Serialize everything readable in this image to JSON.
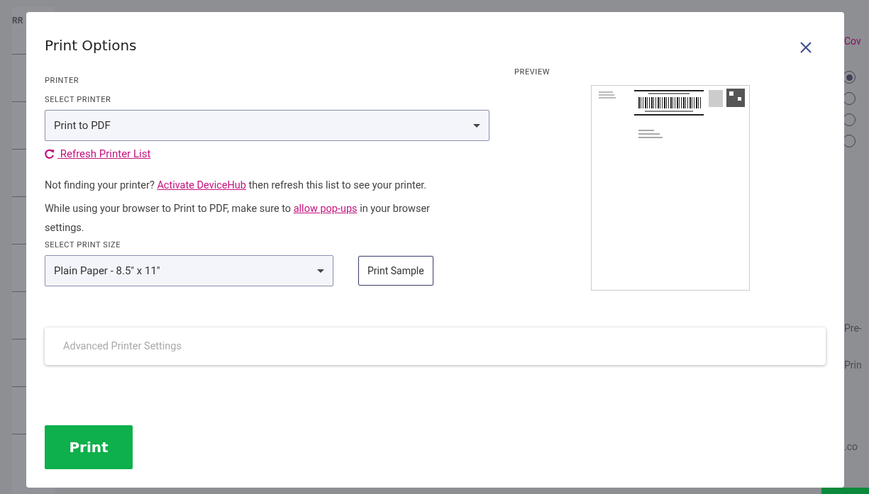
{
  "backdrop": {
    "left_texts": [
      "RR"
    ],
    "right_texts": [
      {
        "kind": "link",
        "text": "Cov"
      },
      {
        "kind": "plain",
        "text": "Pre-"
      },
      {
        "kind": "plain",
        "text": "Prin"
      },
      {
        "kind": "plain",
        "text": ".co"
      }
    ],
    "radios": [
      {
        "selected": true
      },
      {
        "selected": false
      },
      {
        "selected": false
      },
      {
        "selected": false
      }
    ]
  },
  "dialog": {
    "title": "Print Options",
    "printer_section": "PRINTER",
    "select_printer_label": "SELECT PRINTER",
    "printer_value": "Print to PDF",
    "refresh_link": "Refresh Printer List",
    "help_1": {
      "before": "Not finding your printer?",
      "link": "Activate DeviceHub",
      "after": "then refresh this list to see your printer."
    },
    "help_2": {
      "before": "While using your browser to Print to PDF, make sure to",
      "link": "allow pop-ups",
      "after": "in your browser settings."
    },
    "select_size_label": "SELECT PRINT SIZE",
    "size_value": "Plain Paper - 8.5\" x 11\"",
    "sample_button": "Print Sample",
    "preview_label": "PREVIEW",
    "advanced": {
      "label": "Advanced Printer Settings",
      "disabled": true
    },
    "print_button": "Print"
  }
}
